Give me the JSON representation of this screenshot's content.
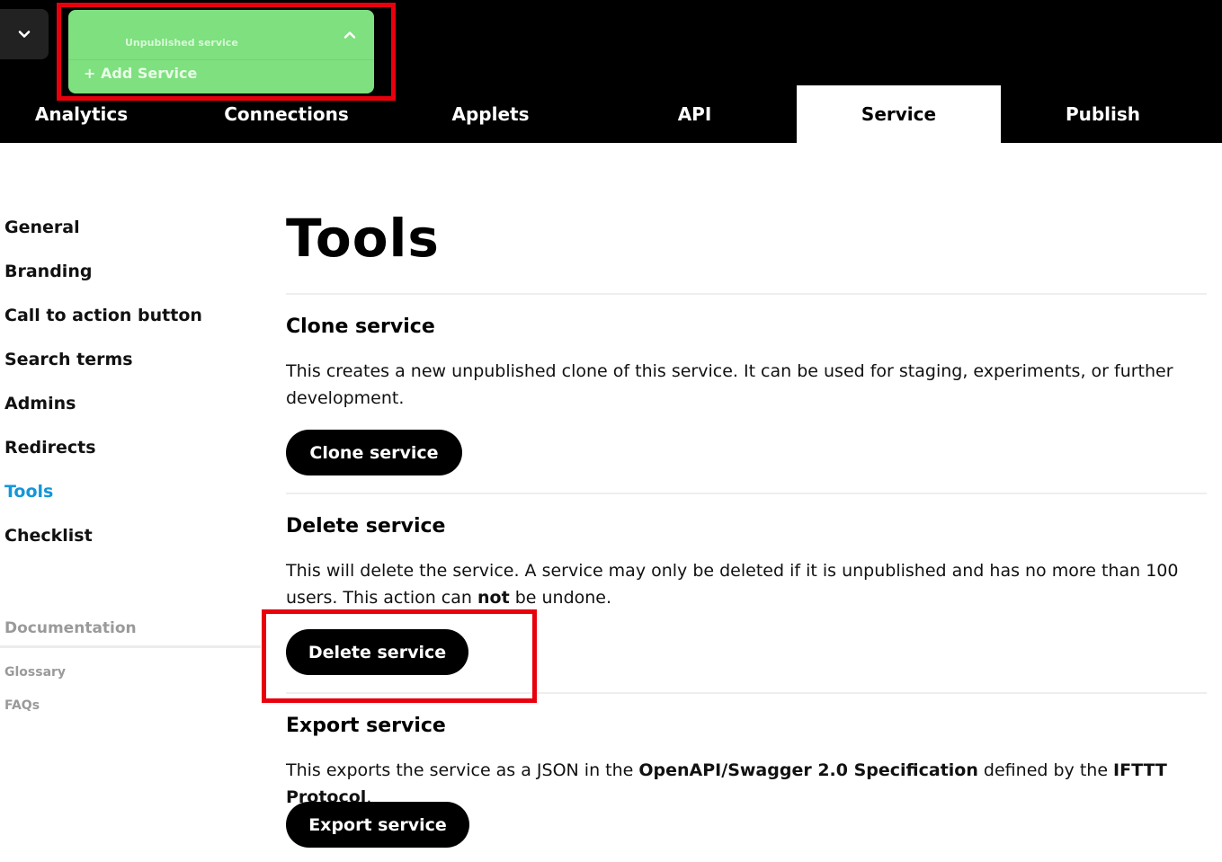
{
  "header": {
    "service_switcher": {
      "current_service": "Unpublished service",
      "add_service_label": "+ Add Service"
    },
    "tabs": [
      {
        "label": "Analytics",
        "active": false
      },
      {
        "label": "Connections",
        "active": false
      },
      {
        "label": "Applets",
        "active": false
      },
      {
        "label": "API",
        "active": false
      },
      {
        "label": "Service",
        "active": true
      },
      {
        "label": "Publish",
        "active": false
      }
    ]
  },
  "sidebar": {
    "items": [
      {
        "label": "General"
      },
      {
        "label": "Branding"
      },
      {
        "label": "Call to action button"
      },
      {
        "label": "Search terms"
      },
      {
        "label": "Admins"
      },
      {
        "label": "Redirects"
      },
      {
        "label": "Tools",
        "active": true
      },
      {
        "label": "Checklist"
      }
    ],
    "documentation": {
      "heading": "Documentation",
      "links": [
        {
          "label": "Glossary"
        },
        {
          "label": "FAQs"
        }
      ]
    }
  },
  "main": {
    "title": "Tools",
    "clone": {
      "title": "Clone service",
      "description": "This creates a new unpublished clone of this service. It can be used for staging, experiments, or further development.",
      "button": "Clone service"
    },
    "delete": {
      "title": "Delete service",
      "description_1": "This will delete the service. A service may only be deleted if it is unpublished and has no more than 100 users. This action can ",
      "description_bold": "not",
      "description_2": " be undone.",
      "button": "Delete service"
    },
    "export": {
      "title": "Export service",
      "description_1": "This exports the service as a JSON in the ",
      "spec_bold": "OpenAPI/Swagger 2.0 Specification",
      "description_2": " defined by the ",
      "protocol_bold": "IFTTT Protocol",
      "description_3": ".",
      "button": "Export service"
    }
  },
  "colors": {
    "header_bg": "#000000",
    "switcher_bg": "#7ee07e",
    "active_sidebar": "#1496d8",
    "highlight": "#e8000d"
  }
}
